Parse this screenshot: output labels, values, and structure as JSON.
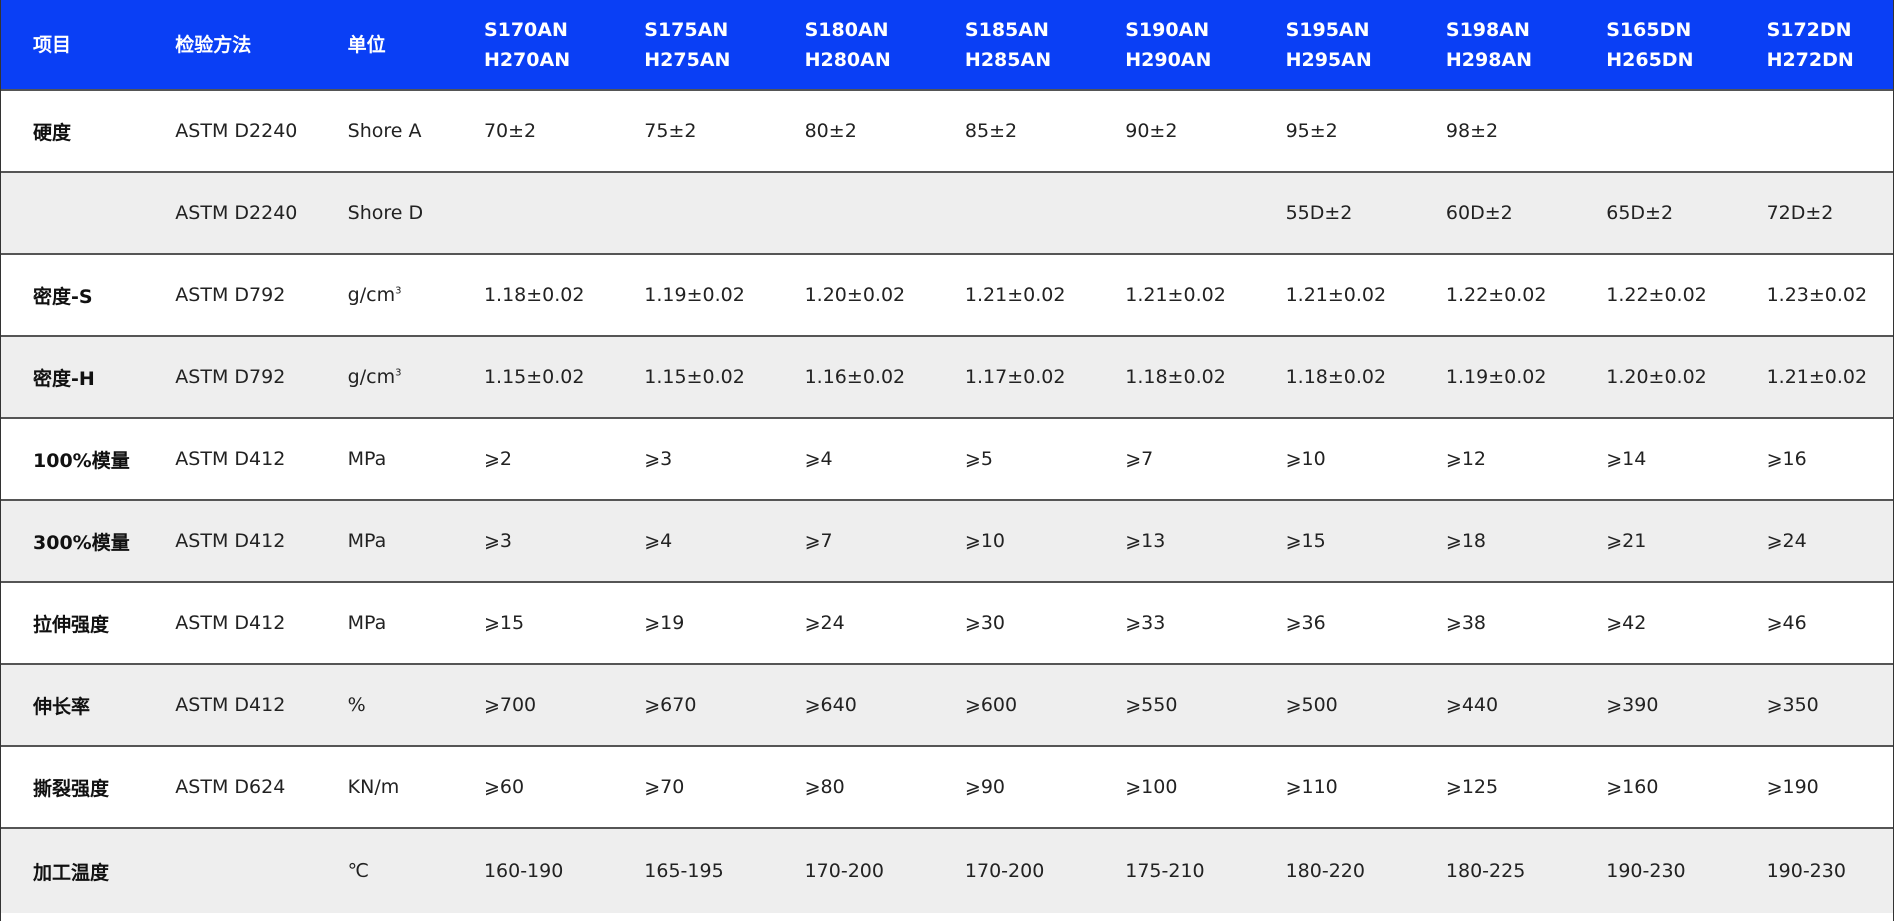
{
  "header": {
    "item": "项目",
    "method": "检验方法",
    "unit": "单位",
    "grades": [
      [
        "S170AN",
        "H270AN"
      ],
      [
        "S175AN",
        "H275AN"
      ],
      [
        "S180AN",
        "H280AN"
      ],
      [
        "S185AN",
        "H285AN"
      ],
      [
        "S190AN",
        "H290AN"
      ],
      [
        "S195AN",
        "H295AN"
      ],
      [
        "S198AN",
        "H298AN"
      ],
      [
        "S165DN",
        "H265DN"
      ],
      [
        "S172DN",
        "H272DN"
      ]
    ]
  },
  "rows": [
    {
      "item": "硬度",
      "method": "ASTM D2240",
      "unit": "Shore A",
      "values": [
        "70±2",
        "75±2",
        "80±2",
        "85±2",
        "90±2",
        "95±2",
        "98±2",
        "",
        ""
      ]
    },
    {
      "item": "",
      "method": "ASTM D2240",
      "unit": "Shore D",
      "values": [
        "",
        "",
        "",
        "",
        "",
        "55D±2",
        "60D±2",
        "65D±2",
        "72D±2"
      ]
    },
    {
      "item": "密度-S",
      "method": "ASTM D792",
      "unit": "g/cm",
      "unit_sup": "3",
      "values": [
        "1.18±0.02",
        "1.19±0.02",
        "1.20±0.02",
        "1.21±0.02",
        "1.21±0.02",
        "1.21±0.02",
        "1.22±0.02",
        "1.22±0.02",
        "1.23±0.02"
      ]
    },
    {
      "item": "密度-H",
      "method": "ASTM D792",
      "unit": "g/cm",
      "unit_sup": "3",
      "values": [
        "1.15±0.02",
        "1.15±0.02",
        "1.16±0.02",
        "1.17±0.02",
        "1.18±0.02",
        "1.18±0.02",
        "1.19±0.02",
        "1.20±0.02",
        "1.21±0.02"
      ]
    },
    {
      "item": "100%模量",
      "method": "ASTM D412",
      "unit": "MPa",
      "values": [
        "⩾2",
        "⩾3",
        "⩾4",
        "⩾5",
        "⩾7",
        "⩾10",
        "⩾12",
        "⩾14",
        "⩾16"
      ]
    },
    {
      "item": "300%模量",
      "method": "ASTM D412",
      "unit": "MPa",
      "values": [
        "⩾3",
        "⩾4",
        "⩾7",
        "⩾10",
        "⩾13",
        "⩾15",
        "⩾18",
        "⩾21",
        "⩾24"
      ]
    },
    {
      "item": "拉伸强度",
      "method": "ASTM D412",
      "unit": "MPa",
      "values": [
        "⩾15",
        "⩾19",
        "⩾24",
        "⩾30",
        "⩾33",
        "⩾36",
        "⩾38",
        "⩾42",
        "⩾46"
      ]
    },
    {
      "item": "伸长率",
      "method": "ASTM D412",
      "unit": "%",
      "values": [
        "⩾700",
        "⩾670",
        "⩾640",
        "⩾600",
        "⩾550",
        "⩾500",
        "⩾440",
        "⩾390",
        "⩾350"
      ]
    },
    {
      "item": "撕裂强度",
      "method": "ASTM D624",
      "unit": "KN/m",
      "values": [
        "⩾60",
        "⩾70",
        "⩾80",
        "⩾90",
        "⩾100",
        "⩾110",
        "⩾125",
        "⩾160",
        "⩾190"
      ]
    },
    {
      "item": "加工温度",
      "method": "",
      "unit": "℃",
      "values": [
        "160-190",
        "165-195",
        "170-200",
        "170-200",
        "175-210",
        "180-220",
        "180-225",
        "190-230",
        "190-230"
      ]
    }
  ],
  "colors": {
    "header_bg": "#0a3ff5",
    "header_text": "#ffffff",
    "stripe_bg": "#eeeeee",
    "divider": "#555555"
  }
}
